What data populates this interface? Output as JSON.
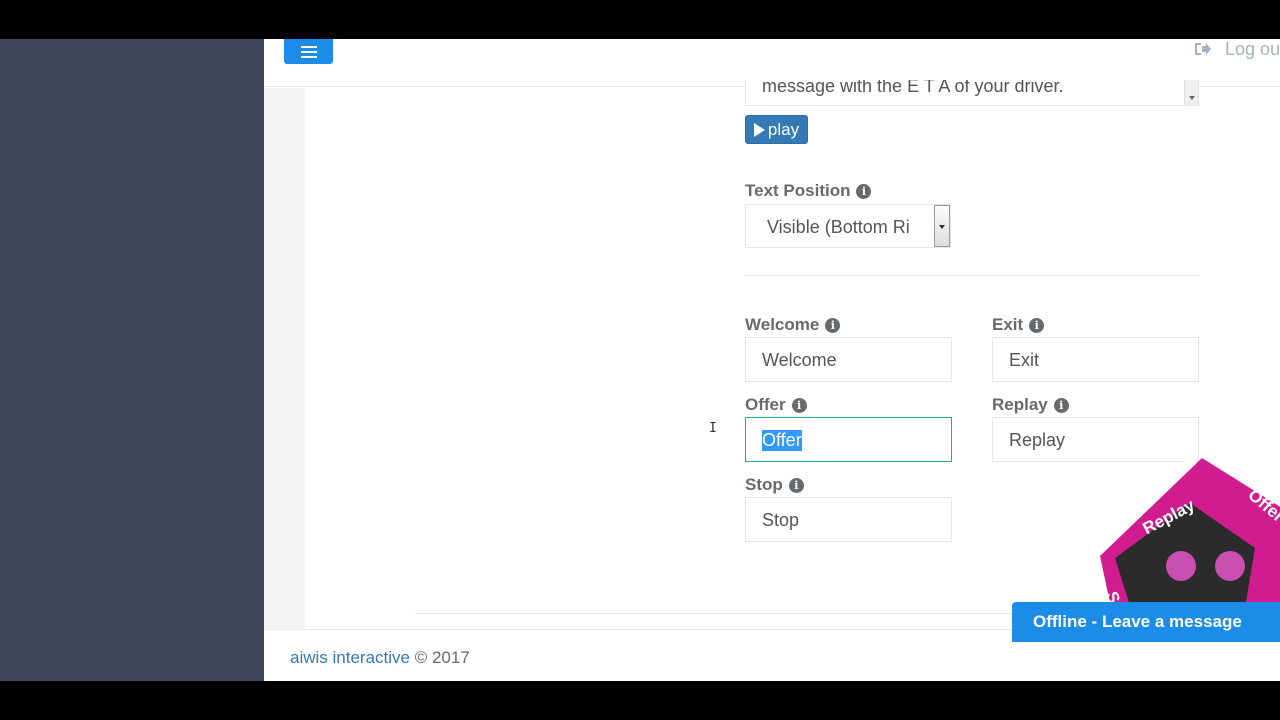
{
  "header": {
    "logout_label": "Log ou",
    "menu_icon": "hamburger-icon",
    "logout_icon": "sign-out-icon"
  },
  "form": {
    "message_text": "message with the E T A of your driver.",
    "play_label": "play",
    "text_position_label": "Text Position",
    "text_position_value": "Visible (Bottom Ri",
    "fields": {
      "welcome": {
        "label": "Welcome",
        "value": "Welcome"
      },
      "exit": {
        "label": "Exit",
        "value": "Exit"
      },
      "offer": {
        "label": "Offer",
        "value": "Offer"
      },
      "replay": {
        "label": "Replay",
        "value": "Replay"
      },
      "stop": {
        "label": "Stop",
        "value": "Stop"
      }
    }
  },
  "footer": {
    "brand": "aiwis interactive",
    "copyright": " © 2017"
  },
  "chat": {
    "offline_label": "Offline - Leave a message"
  },
  "widget": {
    "labels": [
      "Replay",
      "Offer",
      "Stop"
    ],
    "colors": {
      "accent": "#d11c90",
      "face": "#2a2a2a",
      "eyes": "#c94fb0"
    }
  },
  "colors": {
    "sidebar": "#3f465c",
    "primary": "#1c8ce8",
    "focus_border": "#1ab394"
  }
}
